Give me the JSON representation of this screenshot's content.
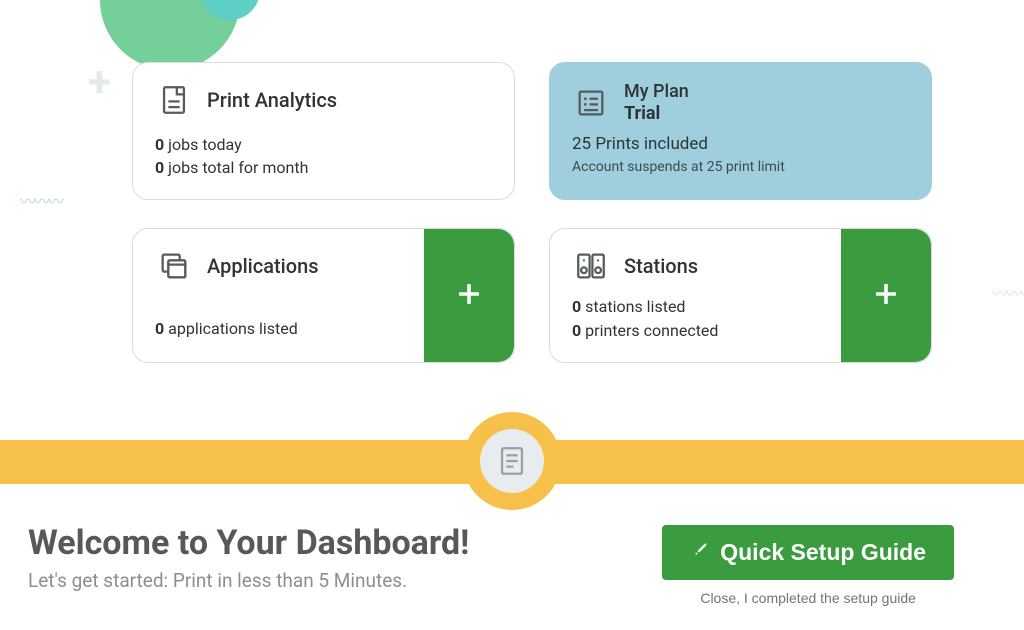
{
  "cards": {
    "analytics": {
      "title": "Print Analytics",
      "jobs_today_count": "0",
      "jobs_today_label": " jobs today",
      "jobs_month_count": "0",
      "jobs_month_label": " jobs total for month"
    },
    "plan": {
      "heading": "My Plan",
      "name": "Trial",
      "included": "25 Prints included",
      "note": "Account suspends at 25 print limit"
    },
    "applications": {
      "title": "Applications",
      "count": "0",
      "label": " applications listed"
    },
    "stations": {
      "title": "Stations",
      "stations_count": "0",
      "stations_label": " stations listed",
      "printers_count": "0",
      "printers_label": " printers connected"
    }
  },
  "welcome": {
    "title": "Welcome to Your Dashboard!",
    "subtitle": "Let's get started: Print in less than 5 Minutes."
  },
  "setup": {
    "button": "Quick Setup Guide",
    "close": "Close, I completed the setup guide"
  },
  "colors": {
    "green": "#3b9b3f",
    "yellow": "#f7c04a",
    "card_blue": "#9fcfdd"
  }
}
